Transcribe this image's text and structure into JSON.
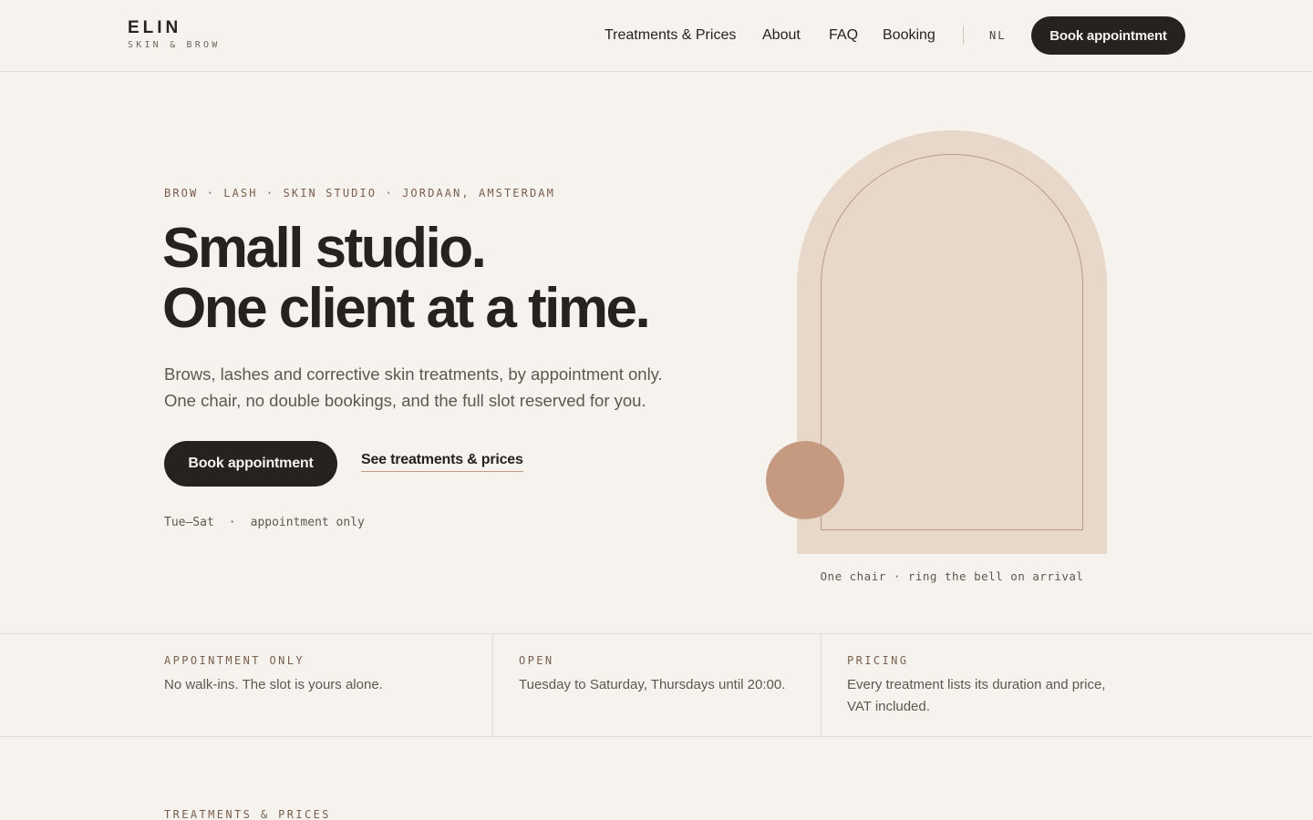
{
  "brand": {
    "name": "ELIN",
    "tagline": "SKIN & BROW"
  },
  "nav": {
    "items": [
      {
        "label": "Treatments & Prices"
      },
      {
        "label": "About"
      },
      {
        "label": "FAQ"
      },
      {
        "label": "Booking"
      }
    ],
    "language": "NL",
    "cta": "Book appointment"
  },
  "hero": {
    "eyebrow": "BROW · LASH · SKIN STUDIO · JORDAAN, AMSTERDAM",
    "headline_line1": "Small studio.",
    "headline_line2": "One client at a time.",
    "lede_line1": "Brows, lashes and corrective skin treatments, by appointment only.",
    "lede_line2": "One chair, no double bookings, and the full slot reserved for you.",
    "primary_cta": "Book appointment",
    "secondary_cta": "See treatments & prices",
    "note_days": "Tue–Sat",
    "note_separator": "·",
    "note_mode": "appointment only",
    "image_caption": "One chair · ring the bell on arrival"
  },
  "info": [
    {
      "label": "APPOINTMENT ONLY",
      "text": "No walk-ins. The slot is yours alone."
    },
    {
      "label": "OPEN",
      "text": "Tuesday to Saturday, Thursdays until 20:00."
    },
    {
      "label": "PRICING",
      "text": "Every treatment lists its duration and price, VAT included."
    }
  ],
  "next_section": {
    "label": "TREATMENTS & PRICES"
  },
  "colors": {
    "background": "#f6f3ee",
    "ink": "#26221e",
    "accent": "#c59a81",
    "arch": "#e8d8ca",
    "label": "#7a5f4e"
  }
}
